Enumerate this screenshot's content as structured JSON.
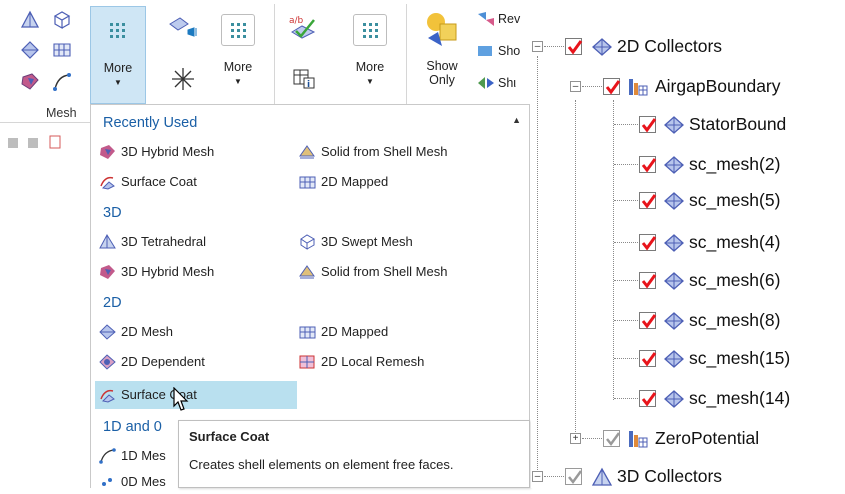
{
  "ribbon": {
    "more_label_1": "More",
    "more_label_2": "More",
    "more_label_3": "More",
    "show_only_label_1": "Show",
    "show_only_label_2": "Only",
    "side_rev": "Rev",
    "side_sho1": "Sho",
    "side_sho2": "Shι",
    "mesh_tab": "Mesh"
  },
  "menu": {
    "sections": {
      "recent": "Recently Used",
      "three_d": "3D",
      "two_d": "2D",
      "one_d": "1D and 0"
    },
    "recent_items": [
      {
        "label": "3D Hybrid Mesh",
        "icon": "hybrid-mesh-icon"
      },
      {
        "label": "Solid from Shell Mesh",
        "icon": "solid-from-shell-icon"
      },
      {
        "label": "Surface Coat",
        "icon": "surface-coat-icon"
      },
      {
        "label": "2D Mapped",
        "icon": "mapped-2d-icon"
      }
    ],
    "three_d_items": [
      {
        "label": "3D Tetrahedral",
        "icon": "tetrahedral-icon"
      },
      {
        "label": "3D Swept Mesh",
        "icon": "swept-mesh-icon"
      },
      {
        "label": "3D Hybrid Mesh",
        "icon": "hybrid-mesh-icon"
      },
      {
        "label": "Solid from Shell Mesh",
        "icon": "solid-from-shell-icon"
      }
    ],
    "two_d_items": [
      {
        "label": "2D Mesh",
        "icon": "mesh-2d-icon"
      },
      {
        "label": "2D Mapped",
        "icon": "mapped-2d-icon"
      },
      {
        "label": "2D Dependent",
        "icon": "dependent-2d-icon"
      },
      {
        "label": "2D Local Remesh",
        "icon": "local-remesh-icon"
      },
      {
        "label": "Surface Coat",
        "icon": "surface-coat-icon"
      }
    ],
    "one_d_items": [
      {
        "label": "1D Mes",
        "icon": "mesh-1d-icon"
      },
      {
        "label": "0D Mes",
        "icon": "mesh-0d-icon"
      }
    ],
    "tooltip": {
      "title": "Surface Coat",
      "description": "Creates shell elements on element free faces."
    }
  },
  "tree": {
    "collectors_2d": "2D Collectors",
    "airgap": "AirgapBoundary",
    "children": [
      "StatorBound",
      "sc_mesh(2)",
      "sc_mesh(5)",
      "sc_mesh(4)",
      "sc_mesh(6)",
      "sc_mesh(8)",
      "sc_mesh(15)",
      "sc_mesh(14)"
    ],
    "zero_potential": "ZeroPotential",
    "collectors_3d": "3D Collectors"
  },
  "colors": {
    "accent_blue": "#1a5fa6",
    "hover_bg": "#b9e0ef",
    "check_red": "#e8141b"
  }
}
